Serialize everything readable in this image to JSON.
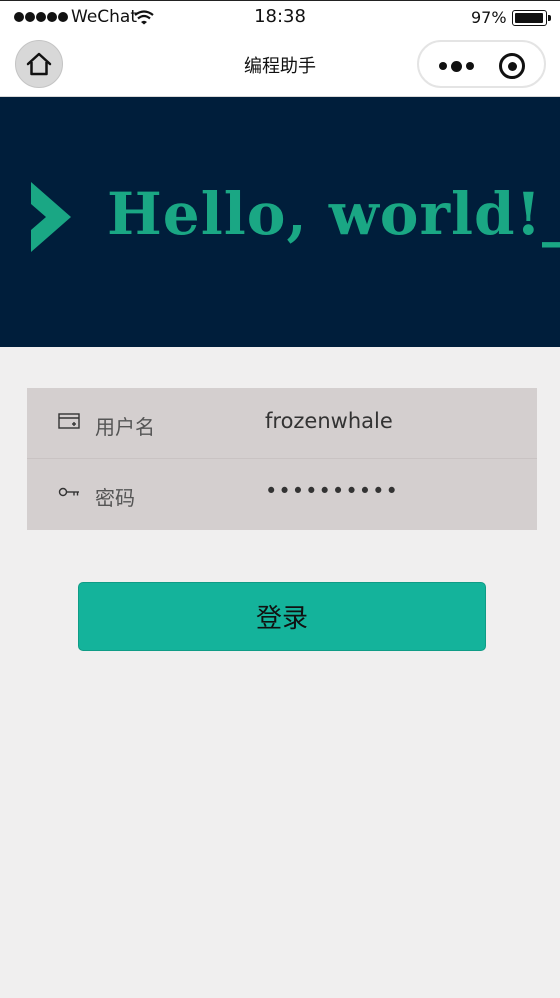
{
  "status_bar": {
    "carrier": "WeChat",
    "time": "18:38",
    "battery_percent": "97%",
    "battery_level": 0.97
  },
  "nav": {
    "title": "编程助手",
    "icons": [
      "home-icon",
      "more-icon",
      "close-circle-icon"
    ]
  },
  "banner": {
    "text": "Hello, world!_",
    "text_color": "#1aa784",
    "background": "#001e3b"
  },
  "form": {
    "username_label": "用户名",
    "username_value": "frozenwhale",
    "password_label": "密码",
    "password_value": "••••••••••"
  },
  "login_button": {
    "label": "登录",
    "color": "#14b39b"
  }
}
